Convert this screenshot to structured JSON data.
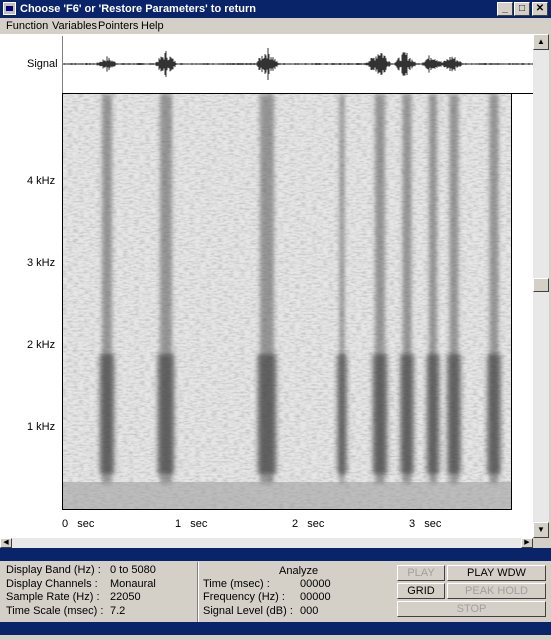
{
  "window": {
    "title": "Choose 'F6' or 'Restore Parameters' to return",
    "minimize": "_",
    "maximize": "□",
    "close": "✕"
  },
  "menu": [
    "Function",
    "Variables",
    "Pointers",
    "Help"
  ],
  "signal_label": "Signal",
  "freq_labels": [
    "4 kHz",
    "3 kHz",
    "2 kHz",
    "1 kHz"
  ],
  "time_labels": [
    {
      "num": "0",
      "unit": "sec"
    },
    {
      "num": "1",
      "unit": "sec"
    },
    {
      "num": "2",
      "unit": "sec"
    },
    {
      "num": "3",
      "unit": "sec"
    }
  ],
  "info": {
    "display_band_label": "Display Band (Hz) :",
    "display_band_value": "0 to 5080",
    "display_channels_label": "Display Channels :",
    "display_channels_value": "Monaural",
    "sample_rate_label": "Sample Rate (Hz) :",
    "sample_rate_value": "22050",
    "time_scale_label": "Time Scale (msec) :",
    "time_scale_value": "7.2"
  },
  "analyze": {
    "title": "Analyze",
    "time_label": "Time (msec) :",
    "time_value": "00000",
    "freq_label": "Frequency (Hz) :",
    "freq_value": "00000",
    "level_label": "Signal Level (dB) :",
    "level_value": "000"
  },
  "buttons": {
    "play": "PLAY",
    "play_wdw": "PLAY WDW",
    "grid": "GRID",
    "peak_hold": "PEAK HOLD",
    "stop": "STOP"
  }
}
